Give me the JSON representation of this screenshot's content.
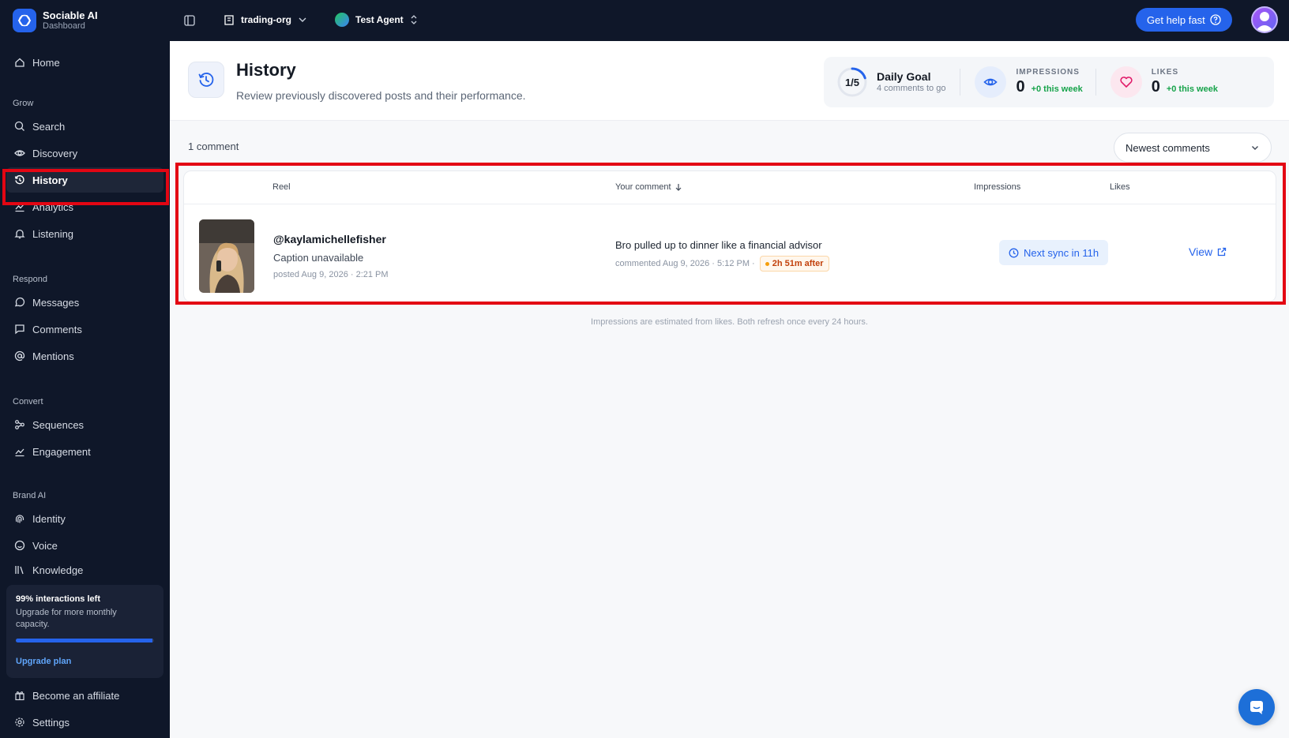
{
  "brand": {
    "name": "Sociable AI",
    "subtitle": "Dashboard"
  },
  "topbar": {
    "org": "trading-org",
    "agent": "Test Agent",
    "help_label": "Get help fast"
  },
  "sidebar": {
    "home": "Home",
    "grow_label": "Grow",
    "grow": [
      {
        "label": "Search",
        "icon": "search-icon"
      },
      {
        "label": "Discovery",
        "icon": "eye-icon"
      },
      {
        "label": "History",
        "icon": "history-icon",
        "active": true
      },
      {
        "label": "Analytics",
        "icon": "chart-icon"
      },
      {
        "label": "Listening",
        "icon": "bell-icon"
      }
    ],
    "respond_label": "Respond",
    "respond": [
      {
        "label": "Messages",
        "icon": "message-icon"
      },
      {
        "label": "Comments",
        "icon": "comment-icon"
      },
      {
        "label": "Mentions",
        "icon": "at-icon"
      }
    ],
    "convert_label": "Convert",
    "convert": [
      {
        "label": "Sequences",
        "icon": "sequence-icon"
      },
      {
        "label": "Engagement",
        "icon": "chart-icon"
      }
    ],
    "brand_label": "Brand AI",
    "brand_items": [
      {
        "label": "Identity",
        "icon": "fingerprint-icon"
      },
      {
        "label": "Voice",
        "icon": "smile-icon"
      },
      {
        "label": "Knowledge",
        "icon": "book-icon"
      }
    ],
    "upgrade": {
      "title": "99% interactions left",
      "desc": "Upgrade for more monthly capacity.",
      "progress": 0.99,
      "link": "Upgrade plan"
    },
    "affiliate": "Become an affiliate",
    "settings": "Settings"
  },
  "header": {
    "title": "History",
    "subtitle": "Review previously discovered posts and their performance.",
    "goal": {
      "ratio": "1/5",
      "title": "Daily Goal",
      "sub": "4 comments to go",
      "progress": 0.2
    },
    "impressions": {
      "label": "IMPRESSIONS",
      "value": "0",
      "delta": "+0 this week"
    },
    "likes": {
      "label": "LIKES",
      "value": "0",
      "delta": "+0 this week"
    }
  },
  "list": {
    "count": "1 comment",
    "sort": "Newest comments",
    "columns": {
      "reel": "Reel",
      "comment": "Your comment",
      "impressions": "Impressions",
      "likes": "Likes"
    },
    "rows": [
      {
        "handle": "@kaylamichellefisher",
        "caption": "Caption unavailable",
        "posted": "posted Aug 9, 2026 · 2:21 PM",
        "comment": "Bro pulled up to dinner like a financial advisor",
        "commented": "commented Aug 9, 2026 · 5:12 PM ·",
        "after": "2h 51m after",
        "sync": "Next sync in 11h",
        "view": "View"
      }
    ],
    "footnote": "Impressions are estimated from likes. Both refresh once every 24 hours."
  },
  "colors": {
    "accent": "#2563eb",
    "sidebar": "#0f1729",
    "highlight": "#e30613",
    "positive": "#16a34a"
  }
}
